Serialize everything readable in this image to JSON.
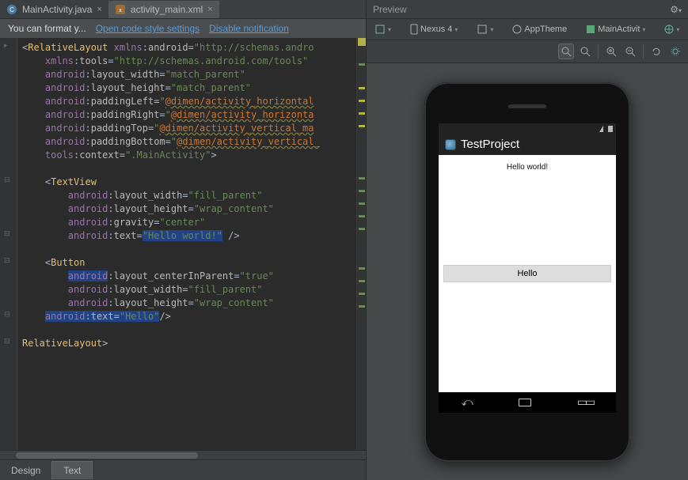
{
  "tabs": [
    {
      "label": "MainActivity.java",
      "active": false,
      "icon": "java"
    },
    {
      "label": "activity_main.xml",
      "active": true,
      "icon": "xml"
    }
  ],
  "notification": {
    "message": "You can format y...",
    "link1": "Open code style settings",
    "link2": "Disable notification"
  },
  "code_lines_html_rendered": true,
  "code": {
    "l1": {
      "pre": "<",
      "tag": "RelativeLayout",
      "sp": " ",
      "ns": "xmlns",
      "colon": ":",
      "attr": "android",
      "eq": "=",
      "val": "\"http://schemas.andro"
    },
    "l2": {
      "ns": "xmlns",
      "attr": "tools",
      "val": "\"http://schemas.android.com/tools\""
    },
    "l3": {
      "ns": "android",
      "attr": "layout_width",
      "val": "\"match_parent\""
    },
    "l4": {
      "ns": "android",
      "attr": "layout_height",
      "val": "\"match_parent\""
    },
    "l5": {
      "ns": "android",
      "attr": "paddingLeft",
      "val_pref": "\"",
      "pkg": "@dimen/activity_horizontal"
    },
    "l6": {
      "ns": "android",
      "attr": "paddingRight",
      "val_pref": "\"",
      "pkg": "@dimen/activity_horizonta"
    },
    "l7": {
      "ns": "android",
      "attr": "paddingTop",
      "val_pref": "\"",
      "pkg": "@dimen/activity_vertical_ma"
    },
    "l8": {
      "ns": "android",
      "attr": "paddingBottom",
      "val_pref": "\"",
      "pkg": "@dimen/activity_vertical_"
    },
    "l9": {
      "ns": "tools",
      "attr": "context",
      "val": "\".MainActivity\"",
      "suffix": ">"
    },
    "l10": "",
    "l11": {
      "pre": "<",
      "tag": "TextView"
    },
    "l12": {
      "ns": "android",
      "attr": "layout_width",
      "val": "\"fill_parent\""
    },
    "l13": {
      "ns": "android",
      "attr": "layout_height",
      "val": "\"wrap_content\""
    },
    "l14": {
      "ns": "android",
      "attr": "gravity",
      "val": "\"center\""
    },
    "l15": {
      "ns": "android",
      "attr": "text",
      "val": "\"Hello world!\"",
      "suffix": " />"
    },
    "l16": "",
    "l17": {
      "pre": "<",
      "tag": "Button"
    },
    "l18": {
      "ns": "android",
      "attr": "layout_centerInParent",
      "val": "\"true\"",
      "hl_ns": true
    },
    "l19": {
      "ns": "android",
      "attr": "layout_width",
      "val": "\"fill_parent\""
    },
    "l20": {
      "ns": "android",
      "attr": "layout_height",
      "val": "\"wrap_content\""
    },
    "l21": {
      "ns": "android",
      "attr": "text",
      "val": "\"Hello\"",
      "suffix": "/>",
      "hl_all": true
    },
    "l22": "",
    "l23": {
      "close": "</",
      "tag": "RelativeLayout",
      "suffix": ">"
    }
  },
  "bottom_tabs": {
    "design": "Design",
    "text": "Text"
  },
  "preview": {
    "title": "Preview",
    "device": "Nexus 4",
    "theme": "AppTheme",
    "activity": "MainActivit",
    "app_title": "TestProject",
    "hello_world": "Hello world!",
    "button_text": "Hello"
  }
}
